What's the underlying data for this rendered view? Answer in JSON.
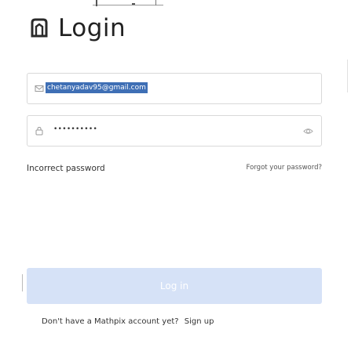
{
  "header": {
    "title": "Login",
    "logo_icon": "mathpix-logo-icon"
  },
  "form": {
    "email": {
      "value": "chetanyadav95@gmail.com",
      "icon": "envelope-icon"
    },
    "password": {
      "value": "••••••••••",
      "icon": "lock-icon",
      "toggle_icon": "eye-icon"
    },
    "error_message": "Incorrect password",
    "forgot_link": "Forgot your password?",
    "submit_label": "Log in"
  },
  "footer": {
    "prompt": "Don't have a Mathpix account yet?",
    "signup_link": "Sign up"
  },
  "colors": {
    "button_bg": "#d6e2f7",
    "selection_bg": "#3f6fb5"
  }
}
